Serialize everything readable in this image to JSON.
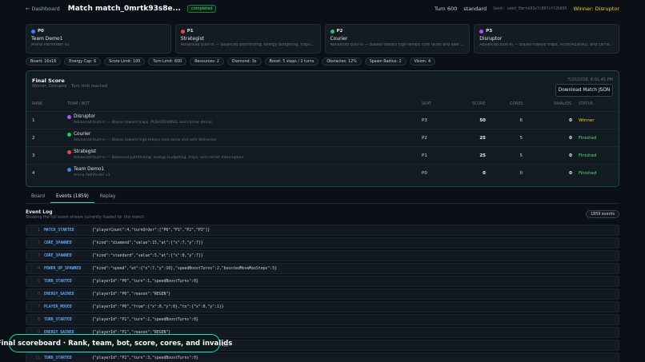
{
  "header": {
    "back_label": "← Dashboard",
    "title": "Match match_0mrtk93s8e...",
    "status": "completed",
    "turn": "Turn 600",
    "mode": "standard",
    "seed": "Seed: seed_0mrtk93s7c807cff2b695",
    "winner": "Winner: Disruptor"
  },
  "players": [
    {
      "seat": "P0",
      "name": "Team Demo1",
      "desc": "Arena Pathfinder v1",
      "color": "#3b82f6"
    },
    {
      "seat": "P1",
      "name": "Strategist",
      "desc": "Advanced built-in — Balanced pathfinding, energy budgeting, traps, and c...",
      "color": "#ef4444"
    },
    {
      "seat": "P2",
      "name": "Courier",
      "desc": "Advanced built-in — Biases toward high-tempo core races and safe deliver...",
      "color": "#22c55e"
    },
    {
      "seat": "P3",
      "name": "Disruptor",
      "desc": "Advanced built-in — Biases toward traps, PUSH/REWIND, and carrier denial.",
      "color": "#a855f7"
    }
  ],
  "settings": [
    "Board: 16x16",
    "Energy Cap: 6",
    "Score Limit: 100",
    "Turn Limit: 600",
    "Resources: 2",
    "Diamond: 3x",
    "Boost: 5 steps / 2 turns",
    "Obstacles: 12%",
    "Spawn Radius: 2",
    "Vision: 4"
  ],
  "final": {
    "title": "Final Score",
    "subtitle": "Winner: Disruptor · Turn limit reached",
    "date": "7/20/2026, 8:01:45 PM",
    "download_label": "Download Match JSON",
    "columns": [
      "RANK",
      "TEAM / BOT",
      "SEAT",
      "SCORE",
      "CORES",
      "INVALIDS",
      "STATUS"
    ],
    "rows": [
      {
        "rank": "1",
        "name": "Disruptor",
        "desc": "Advanced built-in — Biases toward traps, PUSH/REWIND, and carrier denial.",
        "color": "#a855f7",
        "seat": "P3",
        "score": "50",
        "cores": "6",
        "invalids": "0",
        "status": "Winner",
        "status_color": "#facc15"
      },
      {
        "rank": "2",
        "name": "Courier",
        "desc": "Advanced built-in — Biases toward high-tempo core races and safe deliveries.",
        "color": "#22c55e",
        "seat": "P2",
        "score": "25",
        "cores": "5",
        "invalids": "0",
        "status": "Finished",
        "status_color": "#4ade80"
      },
      {
        "rank": "3",
        "name": "Strategist",
        "desc": "Advanced built-in — Balanced pathfinding, energy budgeting, traps, and carrier interception.",
        "color": "#ef4444",
        "seat": "P1",
        "score": "25",
        "cores": "5",
        "invalids": "0",
        "status": "Finished",
        "status_color": "#4ade80"
      },
      {
        "rank": "4",
        "name": "Team Demo1",
        "desc": "Arena Pathfinder v1",
        "color": "#3b82f6",
        "seat": "P0",
        "score": "0",
        "cores": "0",
        "invalids": "0",
        "status": "Finished",
        "status_color": "#4ade80"
      }
    ]
  },
  "tabs": [
    "Board",
    "Events (1859)",
    "Replay"
  ],
  "event_log": {
    "title": "Event Log",
    "subtitle": "Showing the full event stream currently loaded for this match.",
    "count": "1859 events",
    "events": [
      {
        "n": "1",
        "kind": "MATCH_STARTED",
        "payload": "{\"playerCount\":4,\"turnOrder\":[\"P0\",\"P1\",\"P2\",\"P3\"]}"
      },
      {
        "n": "2",
        "kind": "CORE_SPAWNED",
        "payload": "{\"kind\":\"diamond\",\"value\":15,\"at\":{\"x\":7,\"y\":7}}"
      },
      {
        "n": "3",
        "kind": "CORE_SPAWNED",
        "payload": "{\"kind\":\"standard\",\"value\":5,\"at\":{\"x\":0,\"y\":7}}"
      },
      {
        "n": "4",
        "kind": "POWER_UP_SPAWNED",
        "payload": "{\"kind\":\"speed\",\"at\":{\"x\":7,\"y\":10},\"speedBoostTurns\":2,\"boostedMoveMaxSteps\":5}"
      },
      {
        "n": "5",
        "kind": "TURN_STARTED",
        "payload": "{\"playerId\":\"P0\",\"turn\":1,\"speedBoostTurns\":0}"
      },
      {
        "n": "6",
        "kind": "ENERGY_GAINED",
        "payload": "{\"playerId\":\"P0\",\"reason\":\"REGEN\"}"
      },
      {
        "n": "7",
        "kind": "PLAYER_MOVED",
        "payload": "{\"playerId\":\"P0\",\"from\":{\"x\":0,\"y\":0},\"to\":{\"x\":0,\"y\":1}}"
      },
      {
        "n": "8",
        "kind": "TURN_STARTED",
        "payload": "{\"playerId\":\"P1\",\"turn\":2,\"speedBoostTurns\":0}"
      },
      {
        "n": "9",
        "kind": "ENERGY_GAINED",
        "payload": "{\"playerId\":\"P1\",\"reason\":\"REGEN\"}"
      },
      {
        "n": "10",
        "kind": "PLAYER_MOVED",
        "payload": "{\"playerId\":\"P1\",\"from\":{\"x\":15,\"y\":0},\"to\":{\"x\":15,\"y\":1}}"
      },
      {
        "n": "11",
        "kind": "TURN_STARTED",
        "payload": "{\"playerId\":\"P2\",\"turn\":3,\"speedBoostTurns\":0}"
      }
    ]
  },
  "caption": "Final scoreboard · Rank, team, bot, score, cores, and invalids"
}
